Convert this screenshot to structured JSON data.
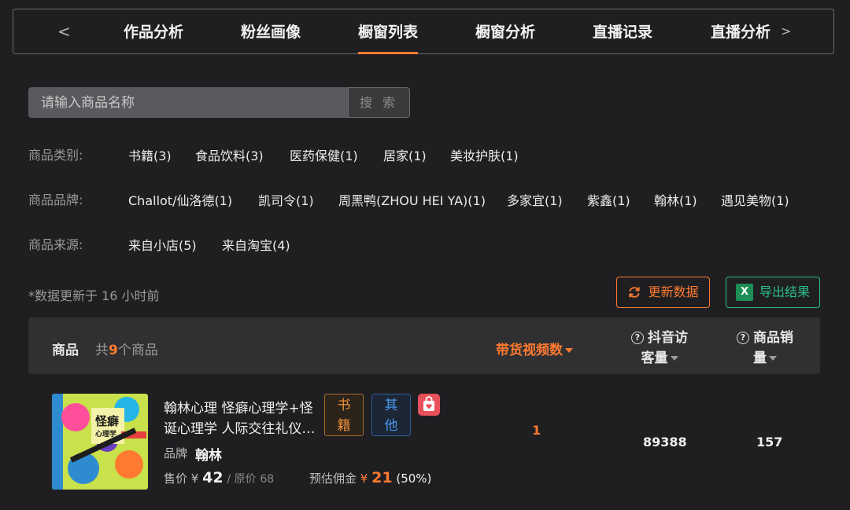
{
  "tabs": {
    "items": [
      "作品分析",
      "粉丝画像",
      "橱窗列表",
      "橱窗分析",
      "直播记录",
      "直播分析"
    ],
    "active": "橱窗列表",
    "prev_icon": "<",
    "next_icon": ">"
  },
  "search": {
    "placeholder": "请输入商品名称",
    "value": "",
    "button_label": "搜 索"
  },
  "filters": {
    "category": {
      "label": "商品类别:",
      "options": [
        "书籍(3)",
        "食品饮料(3)",
        "医药保健(1)",
        "居家(1)",
        "美妆护肤(1)"
      ]
    },
    "brand": {
      "label": "商品品牌:",
      "options": [
        "Challot/仙洛德(1)",
        "凯司令(1)",
        "周黑鸭(ZHOU HEI YA)(1)",
        "多家宜(1)",
        "紫鑫(1)",
        "翰林(1)",
        "遇见美物(1)"
      ]
    },
    "source": {
      "label": "商品来源:",
      "options": [
        "来自小店(5)",
        "来自淘宝(4)"
      ]
    }
  },
  "update_note": "*数据更新于 16 小时前",
  "actions": {
    "refresh_label": "更新数据",
    "export_label": "导出结果",
    "refresh_icon": "refresh-icon",
    "export_icon": "excel-icon",
    "excel_glyph": "X"
  },
  "table": {
    "header": {
      "product": "商品",
      "count_prefix": "共",
      "count": "9",
      "count_suffix": "个商品",
      "video_count": "带货视频数",
      "visits_line1": "抖音访",
      "visits_line2": "客量",
      "sales_line1": "商品销",
      "sales_line2": "量"
    },
    "rows": [
      {
        "title_line1": "翰林心理 怪癖心理学+怪",
        "title_line2": "诞心理学 人际交往礼仪…",
        "tags": [
          {
            "line1": "书",
            "line2": "籍"
          },
          {
            "line1": "其",
            "line2": "他"
          }
        ],
        "brand_label": "品牌",
        "brand": "翰林",
        "price_label": "售价",
        "currency": "¥",
        "price": "42",
        "orig_label": "/ 原价",
        "orig_price": "68",
        "commission_label": "预估佣金",
        "commission": "21",
        "commission_rate": "(50%)",
        "video_count": "1",
        "visits": "89388",
        "sales": "157",
        "cover_title": "怪癖",
        "cover_subtitle": "心理学"
      }
    ]
  },
  "colors": {
    "accent": "#ff7a30",
    "export": "#2bbf88",
    "background": "#1f1f22"
  }
}
